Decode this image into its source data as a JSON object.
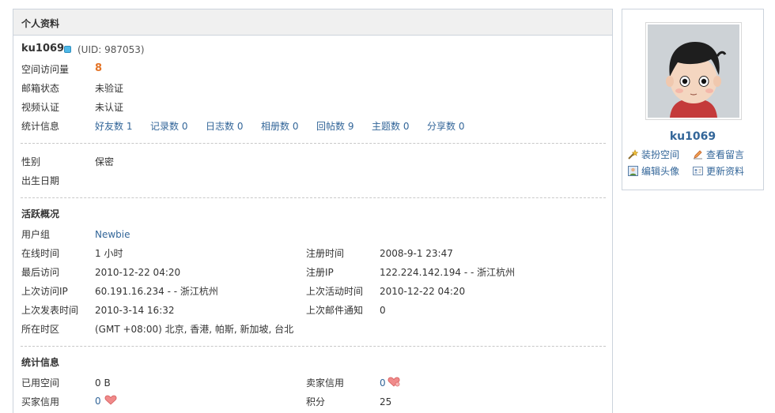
{
  "panel": {
    "title": "个人资料"
  },
  "user": {
    "name": "ku1069",
    "uid": "(UID: 987053)"
  },
  "basic": {
    "visits_label": "空间访问量",
    "visits_value": "8",
    "email_label": "邮箱状态",
    "email_value": "未验证",
    "video_label": "视频认证",
    "video_value": "未认证",
    "stats_label": "统计信息",
    "stats": [
      {
        "label": "好友数 1"
      },
      {
        "label": "记录数 0"
      },
      {
        "label": "日志数 0"
      },
      {
        "label": "相册数 0"
      },
      {
        "label": "回帖数 9"
      },
      {
        "label": "主题数 0"
      },
      {
        "label": "分享数 0"
      }
    ]
  },
  "personal": {
    "gender_label": "性别",
    "gender_value": "保密",
    "birth_label": "出生日期"
  },
  "activity": {
    "title": "活跃概况",
    "group_label": "用户组",
    "group_value": "Newbie",
    "online_label": "在线时间",
    "online_value": "1 小时",
    "reg_time_label": "注册时间",
    "reg_time_value": "2008-9-1 23:47",
    "last_visit_label": "最后访问",
    "last_visit_value": "2010-12-22 04:20",
    "reg_ip_label": "注册IP",
    "reg_ip_value": "122.224.142.194 - - 浙江杭州",
    "last_ip_label": "上次访问IP",
    "last_ip_value": "60.191.16.234 - - 浙江杭州",
    "last_active_label": "上次活动时间",
    "last_active_value": "2010-12-22 04:20",
    "last_post_label": "上次发表时间",
    "last_post_value": "2010-3-14 16:32",
    "last_mail_label": "上次邮件通知",
    "last_mail_value": "0",
    "tz_label": "所在时区",
    "tz_value": "(GMT +08:00) 北京, 香港, 帕斯, 新加坡, 台北"
  },
  "statistics": {
    "title": "统计信息",
    "space_label": "已用空间",
    "space_value": "0 B",
    "seller_label": "卖家信用",
    "seller_value": "0",
    "buyer_label": "买家信用",
    "buyer_value": "0",
    "points_label": "积分",
    "points_value": "25"
  },
  "sidebar": {
    "name": "ku1069",
    "actions": [
      "装扮空间",
      "查看留言",
      "编辑头像",
      "更新资料"
    ]
  },
  "icons": [
    "online-status-icon",
    "wand-icon",
    "pencil-icon",
    "image-icon",
    "profile-card-icon",
    "heart-icon"
  ],
  "colors": {
    "link": "#336699",
    "accent": "#e47427",
    "header_bg": "#f0f0f0",
    "border": "#ccd3dc"
  }
}
